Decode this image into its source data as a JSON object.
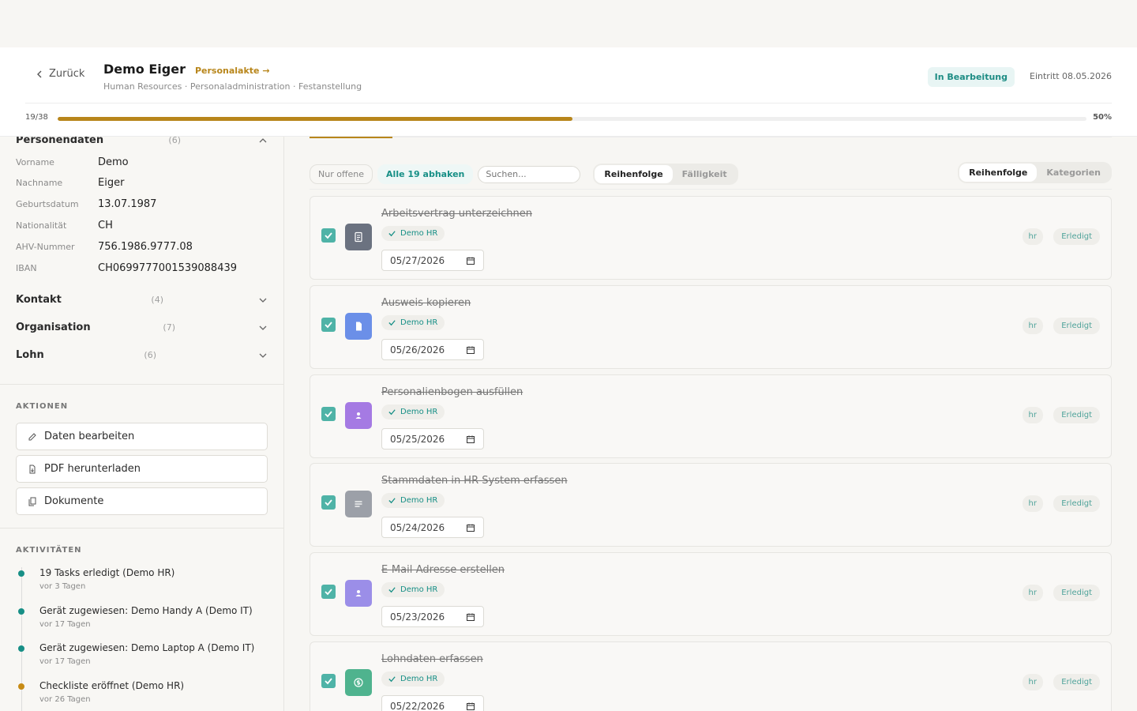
{
  "header": {
    "back_label": "Zurück",
    "title": "Demo Eiger",
    "personalakte_link": "Personalakte →",
    "subtitle": "Human Resources · Personaladministration · Festanstellung",
    "status": "In Bearbeitung",
    "eintritt": "Eintritt 08.05.2026",
    "progress_count": "19/38",
    "progress_fraction": 0.5,
    "progress_pct": "50%"
  },
  "sidebar": {
    "personal": {
      "title": "Personendaten",
      "count": "(6)",
      "fields": [
        {
          "label": "Vorname",
          "value": "Demo"
        },
        {
          "label": "Nachname",
          "value": "Eiger"
        },
        {
          "label": "Geburtsdatum",
          "value": "13.07.1987"
        },
        {
          "label": "Nationalität",
          "value": "CH"
        },
        {
          "label": "AHV-Nummer",
          "value": "756.1986.9777.08"
        },
        {
          "label": "IBAN",
          "value": "CH0699777001539088439"
        }
      ]
    },
    "sections": [
      {
        "title": "Kontakt",
        "count": "(4)"
      },
      {
        "title": "Organisation",
        "count": "(7)"
      },
      {
        "title": "Lohn",
        "count": "(6)"
      }
    ],
    "actions_caption": "AKTIONEN",
    "actions": [
      {
        "label": "Daten bearbeiten",
        "icon": "edit-icon"
      },
      {
        "label": "PDF herunterladen",
        "icon": "file-download-icon"
      },
      {
        "label": "Dokumente",
        "icon": "documents-icon"
      }
    ],
    "activities_caption": "AKTIVITÄTEN",
    "activities": [
      {
        "text": "19 Tasks erledigt (Demo HR)",
        "time": "vor 3 Tagen"
      },
      {
        "text": "Gerät zugewiesen: Demo Handy A (Demo IT)",
        "time": "vor 17 Tagen"
      },
      {
        "text": "Gerät zugewiesen: Demo Laptop A (Demo IT)",
        "time": "vor 17 Tagen"
      },
      {
        "text": "Checkliste eröffnet (Demo HR)",
        "time": "vor 26 Tagen"
      }
    ]
  },
  "toolbar": {
    "only_open": "Nur offene",
    "check_all": "Alle 19 abhaken",
    "search_placeholder": "Suchen...",
    "sort_order": "Reihenfolge",
    "sort_due": "Fälligkeit",
    "view_order": "Reihenfolge",
    "view_categories": "Kategorien"
  },
  "tasks": [
    {
      "name": "Arbeitsvertrag unterzeichnen",
      "assignee": "Demo HR",
      "date": "05/27/2026",
      "tag": "hr",
      "status": "Erledigt",
      "icon": "contract-icon",
      "color": "#6b7280"
    },
    {
      "name": "Ausweis kopieren",
      "assignee": "Demo HR",
      "date": "05/26/2026",
      "tag": "hr",
      "status": "Erledigt",
      "icon": "document-icon",
      "color": "#6b8fe8"
    },
    {
      "name": "Personalienbogen ausfüllen",
      "assignee": "Demo HR",
      "date": "05/25/2026",
      "tag": "hr",
      "status": "Erledigt",
      "icon": "user-icon",
      "color": "#a57ae3"
    },
    {
      "name": "Stammdaten in HR-System erfassen",
      "assignee": "Demo HR",
      "date": "05/24/2026",
      "tag": "hr",
      "status": "Erledigt",
      "icon": "list-icon",
      "color": "#9ca0a8"
    },
    {
      "name": "E-Mail-Adresse erstellen",
      "assignee": "Demo HR",
      "date": "05/23/2026",
      "tag": "hr",
      "status": "Erledigt",
      "icon": "user-icon",
      "color": "#9b8ee8"
    },
    {
      "name": "Lohndaten erfassen",
      "assignee": "Demo HR",
      "date": "05/22/2026",
      "tag": "hr",
      "status": "Erledigt",
      "icon": "money-icon",
      "color": "#4fb38e"
    }
  ]
}
